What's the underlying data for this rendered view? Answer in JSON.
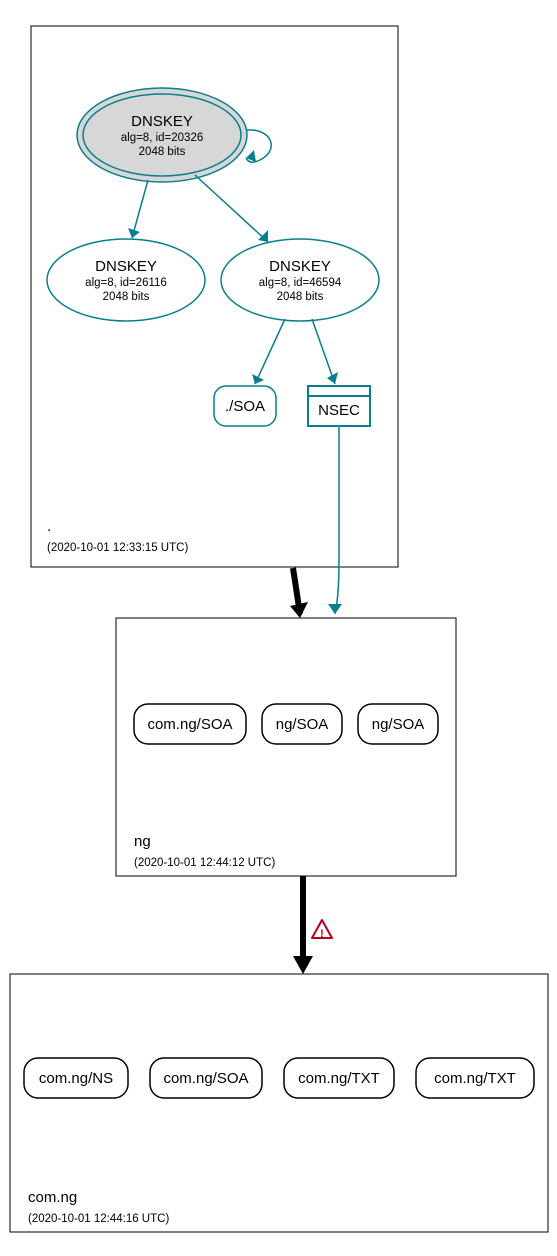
{
  "colors": {
    "teal": "#097e90",
    "grey": "#d7d7d7",
    "warn": "#b00020"
  },
  "zones": {
    "root": {
      "label": ".",
      "timestamp": "(2020-10-01 12:33:15 UTC)"
    },
    "ng": {
      "label": "ng",
      "timestamp": "(2020-10-01 12:44:12 UTC)"
    },
    "com_ng": {
      "label": "com.ng",
      "timestamp": "(2020-10-01 12:44:16 UTC)"
    }
  },
  "nodes": {
    "ksk": {
      "title": "DNSKEY",
      "line2": "alg=8, id=20326",
      "line3": "2048 bits"
    },
    "zsk1": {
      "title": "DNSKEY",
      "line2": "alg=8, id=26116",
      "line3": "2048 bits"
    },
    "zsk2": {
      "title": "DNSKEY",
      "line2": "alg=8, id=46594",
      "line3": "2048 bits"
    },
    "soa_root": {
      "label": "./SOA"
    },
    "nsec": {
      "label": "NSEC"
    },
    "ng_a": {
      "label": "com.ng/SOA"
    },
    "ng_b": {
      "label": "ng/SOA"
    },
    "ng_c": {
      "label": "ng/SOA"
    },
    "cn_a": {
      "label": "com.ng/NS"
    },
    "cn_b": {
      "label": "com.ng/SOA"
    },
    "cn_c": {
      "label": "com.ng/TXT"
    },
    "cn_d": {
      "label": "com.ng/TXT"
    }
  }
}
